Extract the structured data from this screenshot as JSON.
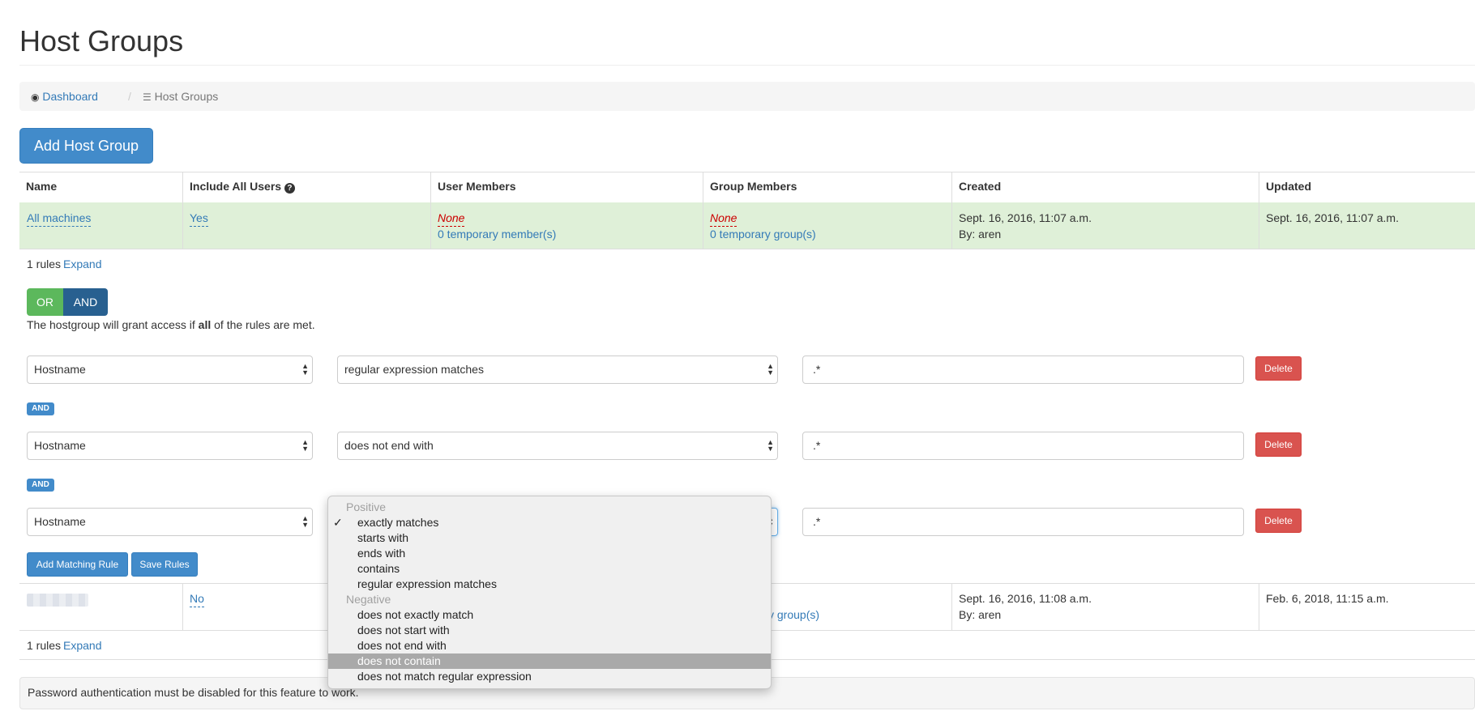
{
  "page": {
    "title": "Host Groups"
  },
  "breadcrumb": {
    "dashboard": "Dashboard",
    "current": "Host Groups"
  },
  "actions": {
    "add_host_group": "Add Host Group"
  },
  "table": {
    "headers": [
      "Name",
      "Include All Users",
      "User Members",
      "Group Members",
      "Created",
      "Updated"
    ],
    "rows": [
      {
        "name": "All machines",
        "include_all_users": "Yes",
        "user_members_none": "None",
        "user_members_temp": "0 temporary member(s)",
        "group_members_none": "None",
        "group_members_temp": "0 temporary group(s)",
        "created": "Sept. 16, 2016, 11:07 a.m.",
        "created_by": "By: aren",
        "updated": "Sept. 16, 2016, 11:07 a.m."
      },
      {
        "include_all_users": "No",
        "group_members_temp_partial": "y group(s)",
        "created": "Sept. 16, 2016, 11:08 a.m.",
        "created_by": "By: aren",
        "updated": "Feb. 6, 2018, 11:15 a.m."
      }
    ]
  },
  "rules_section": {
    "count": "1 rules",
    "expand": "Expand",
    "toggle_or": "OR",
    "toggle_and": "AND",
    "description_pre": "The hostgroup will grant access if ",
    "description_bold": "all",
    "description_post": " of the rules are met.",
    "and_badge": "AND",
    "rules": [
      {
        "field": "Hostname",
        "operator": "regular expression matches",
        "value": ".*"
      },
      {
        "field": "Hostname",
        "operator": "does not end with",
        "value": ".*"
      },
      {
        "field": "Hostname",
        "operator": "",
        "value": ".*"
      }
    ],
    "delete_label": "Delete",
    "add_matching_rule": "Add Matching Rule",
    "save_rules": "Save Rules"
  },
  "row2_rules": {
    "count": "1 rules",
    "expand": "Expand"
  },
  "dropdown": {
    "group_positive": "Positive",
    "positive": [
      "exactly matches",
      "starts with",
      "ends with",
      "contains",
      "regular expression matches"
    ],
    "group_negative": "Negative",
    "negative": [
      "does not exactly match",
      "does not start with",
      "does not end with",
      "does not contain",
      "does not match regular expression"
    ],
    "checked": "exactly matches",
    "highlighted": "does not contain"
  },
  "footer": {
    "note": "Password authentication must be disabled for this feature to work."
  },
  "colors": {
    "primary": "#428bca",
    "success_row": "#dff0d8",
    "danger": "#d9534f",
    "toggle_or": "#5cb85c",
    "toggle_and": "#286090"
  }
}
